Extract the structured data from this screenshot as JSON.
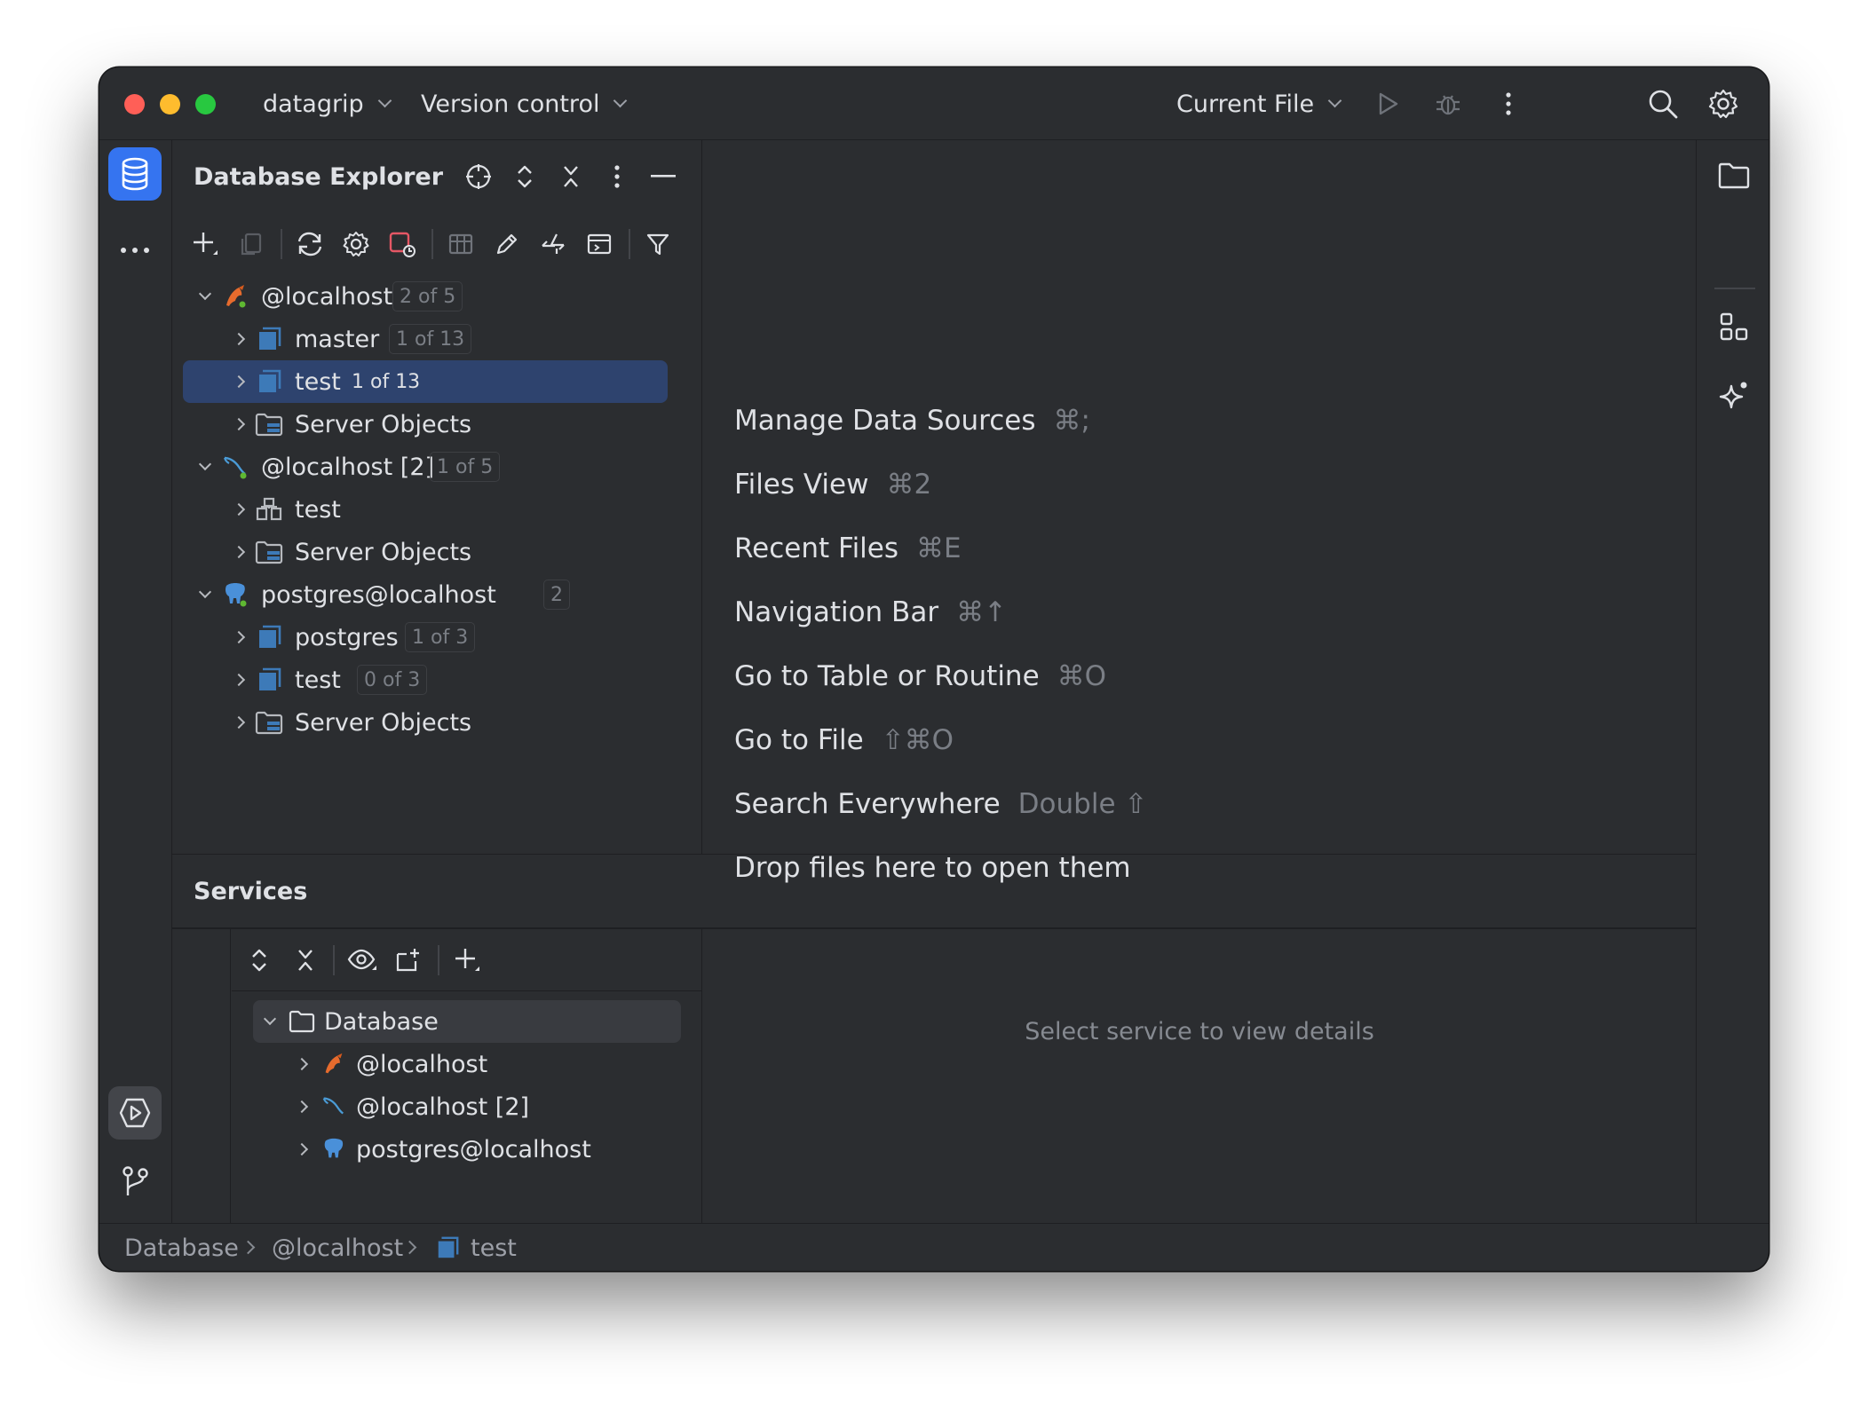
{
  "titlebar": {
    "project": "datagrip",
    "vcs": "Version control",
    "run_config": "Current File"
  },
  "explorer": {
    "title": "Database Explorer",
    "tree": [
      {
        "label": "@localhost",
        "badge": "2 of 5"
      },
      {
        "label": "master",
        "badge": "1 of 13"
      },
      {
        "label": "test",
        "badge": "1 of 13"
      },
      {
        "label": "Server Objects"
      },
      {
        "label": "@localhost [2]",
        "badge": "1 of 5"
      },
      {
        "label": "test"
      },
      {
        "label": "Server Objects"
      },
      {
        "label": "postgres@localhost",
        "badge": "2"
      },
      {
        "label": "postgres",
        "badge": "1 of 3"
      },
      {
        "label": "test",
        "badge": "0 of 3"
      },
      {
        "label": "Server Objects"
      }
    ]
  },
  "editor": {
    "hints": [
      {
        "label": "Manage Data Sources",
        "shortcut": "⌘;"
      },
      {
        "label": "Files View",
        "shortcut": "⌘2"
      },
      {
        "label": "Recent Files",
        "shortcut": "⌘E"
      },
      {
        "label": "Navigation Bar",
        "shortcut": "⌘↑"
      },
      {
        "label": "Go to Table or Routine",
        "shortcut": "⌘O"
      },
      {
        "label": "Go to File",
        "shortcut": "⇧⌘O"
      },
      {
        "label": "Search Everywhere",
        "shortcut": "Double ⇧"
      },
      {
        "label": "Drop files here to open them",
        "shortcut": ""
      }
    ]
  },
  "services": {
    "title": "Services",
    "tree": [
      {
        "label": "Database"
      },
      {
        "label": "@localhost"
      },
      {
        "label": "@localhost [2]"
      },
      {
        "label": "postgres@localhost"
      }
    ],
    "placeholder": "Select service to view details"
  },
  "statusbar": {
    "crumbs": [
      "Database",
      "@localhost",
      "test"
    ]
  },
  "colors": {
    "background": "#2b2d30",
    "selection": "#2e436e",
    "accent": "#3574f0",
    "mysql_orange": "#e66b2d",
    "mysql_blue": "#4a9bd6",
    "postgres_blue": "#4a90d9"
  }
}
